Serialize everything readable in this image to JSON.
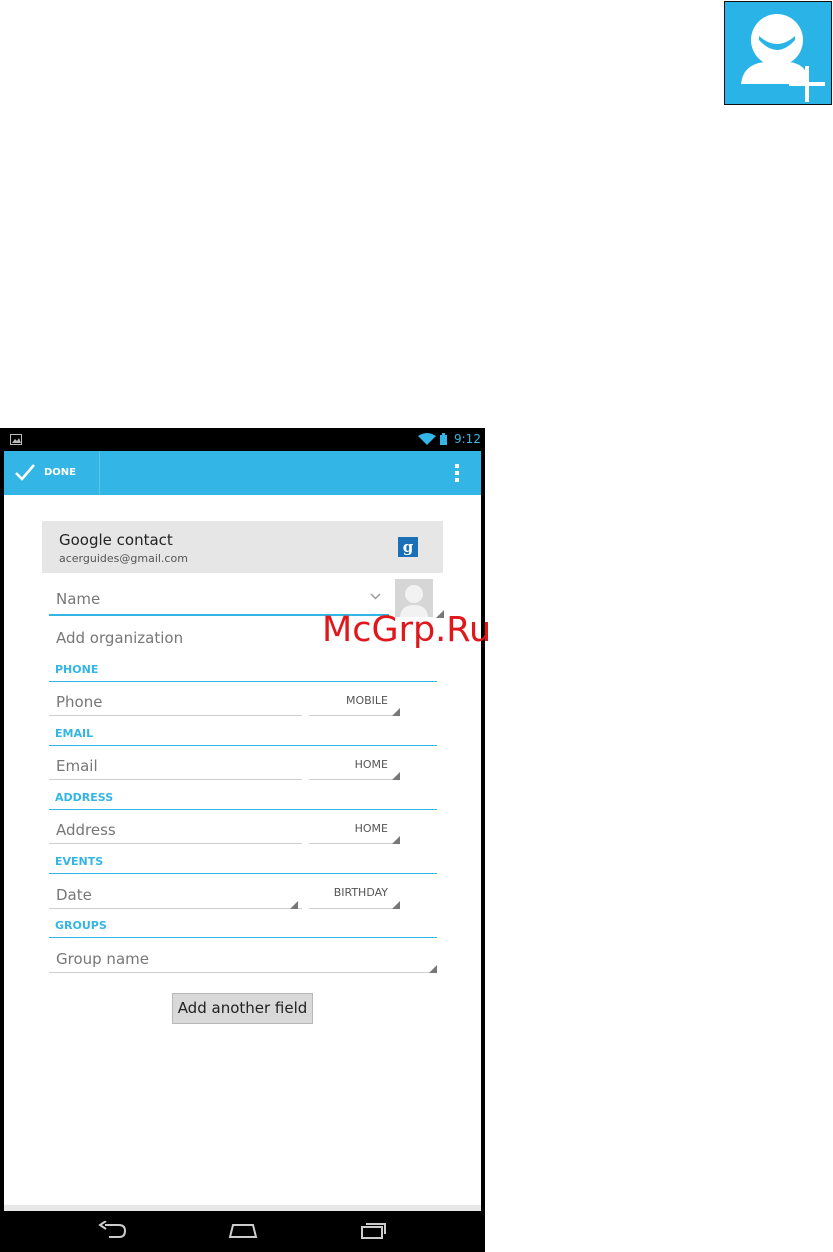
{
  "status_bar": {
    "time": "9:12"
  },
  "action_bar": {
    "done_label": "DONE"
  },
  "account": {
    "type": "Google contact",
    "email": "acerguides@gmail.com",
    "badge": "g"
  },
  "fields": {
    "name_placeholder": "Name",
    "organization": "Add organization",
    "phone_section": "PHONE",
    "phone_placeholder": "Phone",
    "phone_type": "MOBILE",
    "email_section": "EMAIL",
    "email_placeholder": "Email",
    "email_type": "HOME",
    "address_section": "ADDRESS",
    "address_placeholder": "Address",
    "address_type": "HOME",
    "events_section": "EVENTS",
    "date_placeholder": "Date",
    "date_type": "BIRTHDAY",
    "groups_section": "GROUPS",
    "group_placeholder": "Group name"
  },
  "add_field_label": "Add another field",
  "watermark": "McGrp.Ru",
  "colors": {
    "accent": "#33b5e5",
    "icon_bg": "#29b3e6",
    "watermark": "#e0181c"
  }
}
